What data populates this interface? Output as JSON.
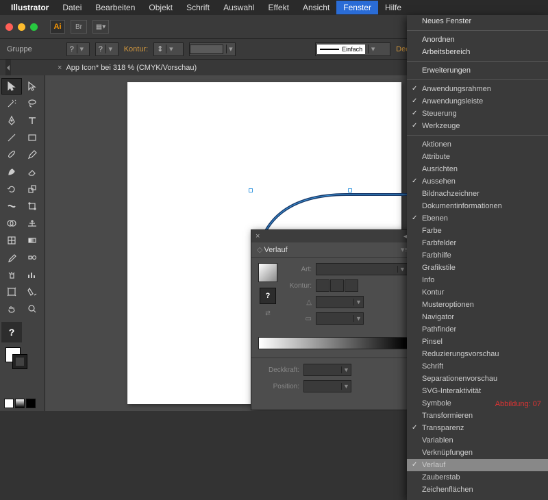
{
  "menubar": {
    "app": "Illustrator",
    "items": [
      "Datei",
      "Bearbeiten",
      "Objekt",
      "Schrift",
      "Auswahl",
      "Effekt",
      "Ansicht",
      "Fenster",
      "Hilfe"
    ],
    "active": "Fenster"
  },
  "titlebar": {
    "badge": "Ai",
    "br": "Br"
  },
  "controlbar": {
    "group": "Gruppe",
    "q1": "?",
    "q2": "?",
    "kontur": "Kontur:",
    "stroke_style": "Einfach",
    "deck": "Deckkr"
  },
  "tab": {
    "name": "App Icon* bei 318 % (CMYK/Vorschau)"
  },
  "dropdown": {
    "top": [
      "Neues Fenster"
    ],
    "g1": [
      "Anordnen",
      "Arbeitsbereich"
    ],
    "g2": [
      "Erweiterungen"
    ],
    "g3": [
      {
        "t": "Anwendungsrahmen",
        "c": true
      },
      {
        "t": "Anwendungsleiste",
        "c": true,
        "dim": true
      },
      {
        "t": "Steuerung",
        "c": true
      },
      {
        "t": "Werkzeuge",
        "c": true
      }
    ],
    "g4": [
      {
        "t": "Aktionen"
      },
      {
        "t": "Attribute"
      },
      {
        "t": "Ausrichten"
      },
      {
        "t": "Aussehen",
        "c": true
      },
      {
        "t": "Bildnachzeichner"
      },
      {
        "t": "Dokumentinformationen"
      },
      {
        "t": "Ebenen",
        "c": true
      },
      {
        "t": "Farbe"
      },
      {
        "t": "Farbfelder"
      },
      {
        "t": "Farbhilfe"
      },
      {
        "t": "Grafikstile"
      },
      {
        "t": "Info"
      },
      {
        "t": "Kontur"
      },
      {
        "t": "Musteroptionen"
      },
      {
        "t": "Navigator"
      },
      {
        "t": "Pathfinder"
      },
      {
        "t": "Pinsel"
      },
      {
        "t": "Reduzierungsvorschau"
      },
      {
        "t": "Schrift"
      },
      {
        "t": "Separationenvorschau"
      },
      {
        "t": "SVG-Interaktivität"
      },
      {
        "t": "Symbole"
      },
      {
        "t": "Transformieren"
      },
      {
        "t": "Transparenz",
        "c": true
      },
      {
        "t": "Variablen"
      },
      {
        "t": "Verknüpfungen"
      },
      {
        "t": "Verlauf",
        "c": true,
        "hl": true
      },
      {
        "t": "Zauberstab"
      },
      {
        "t": "Zeichenflächen"
      }
    ]
  },
  "verlauf": {
    "title": "Verlauf",
    "art": "Art:",
    "kontur": "Kontur:",
    "angle": "△",
    "ratio": "▭",
    "deckkraft": "Deckkraft:",
    "position": "Position:",
    "q": "?"
  },
  "caption": "Abbildung: 07"
}
